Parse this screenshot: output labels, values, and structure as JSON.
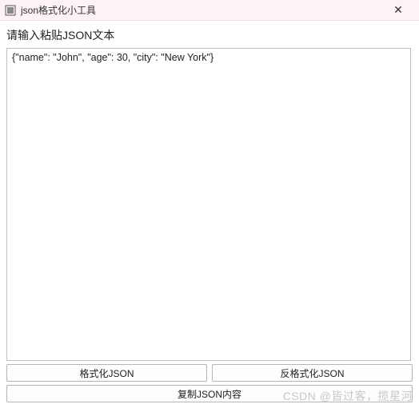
{
  "window": {
    "title": "json格式化小工具"
  },
  "prompt": "请输入粘贴JSON文本",
  "textarea": {
    "value": "{\"name\": \"John\", \"age\": 30, \"city\": \"New York\"}"
  },
  "buttons": {
    "format": "格式化JSON",
    "unformat": "反格式化JSON",
    "copy": "复制JSON内容"
  },
  "watermark": "CSDN @皆过客，揽星河"
}
